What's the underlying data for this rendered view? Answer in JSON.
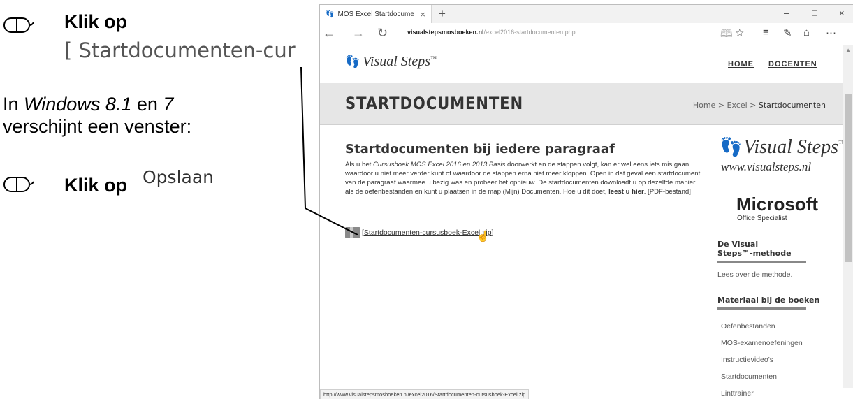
{
  "instructions": {
    "step1_label": "Klik op",
    "step1_crop": "[ Startdocumenten-cur",
    "paragraph_prefix": "In ",
    "paragraph_os1": "Windows 8.1",
    "paragraph_mid": " en ",
    "paragraph_os2": "7",
    "paragraph_line2": "verschijnt een venster:",
    "step2_label": "Klik op",
    "step2_crop": "Opslaan"
  },
  "browser": {
    "tab_title": "MOS Excel Startdocume",
    "tab_close": "×",
    "new_tab": "+",
    "win_minimize": "–",
    "win_maximize": "□",
    "win_close": "×",
    "nav_back": "←",
    "nav_forward": "→",
    "nav_refresh": "↻",
    "url_domain": "visualstepsmosboeken.nl",
    "url_path": "/excel2016-startdocumenten.php",
    "status_url": "http://www.visualstepsmosboeken.nl/excel2016/Startdocumenten-cursusboek-Excel.zip"
  },
  "site": {
    "logo": "Visual Steps",
    "logo_tm": "™",
    "menu": [
      "HOME",
      "DOCENTEN"
    ],
    "page_title": "STARTDOCUMENTEN",
    "breadcrumb": {
      "home": "Home",
      "sep1": " > ",
      "excel": "Excel",
      "sep2": " > ",
      "current": "Startdocumenten"
    },
    "content_title": "Startdocumenten bij iedere paragraaf",
    "body_1": "Als u het ",
    "body_book": "Cursusboek MOS Excel 2016 en 2013 Basis",
    "body_2": " doorwerkt en de stappen volgt, kan er wel eens iets mis gaan waardoor u niet meer verder kunt of waardoor de stappen erna niet meer kloppen. Open in dat geval een startdocument van de paragraaf waarmee u bezig was en probeer het opnieuw. De startdocumenten downloadt u op dezelfde manier als de oefenbestanden en kunt u plaatsen in de map (Mijn) Documenten. Hoe u dit doet, ",
    "body_link": "leest u hier",
    "body_3": ". [PDF-bestand]",
    "download_open": "[ ",
    "download_link": "Startdocumenten-cursusboek-Excel.zip",
    "download_close": " ]"
  },
  "sidebar": {
    "vs_logo": "Visual Steps",
    "vs_tm": "™",
    "vs_url": "www.visualsteps.nl",
    "ms_logo": "Microsoft",
    "ms_sub": "Office Specialist",
    "method_heading_1": "De Visual",
    "method_heading_2": "Steps™-methode",
    "method_text": "Lees over de methode.",
    "materials_heading": "Materiaal bij de boeken",
    "links": [
      "Oefenbestanden",
      "MOS-examenoefeningen",
      "Instructievideo's",
      "Startdocumenten",
      "Linttrainer"
    ]
  }
}
